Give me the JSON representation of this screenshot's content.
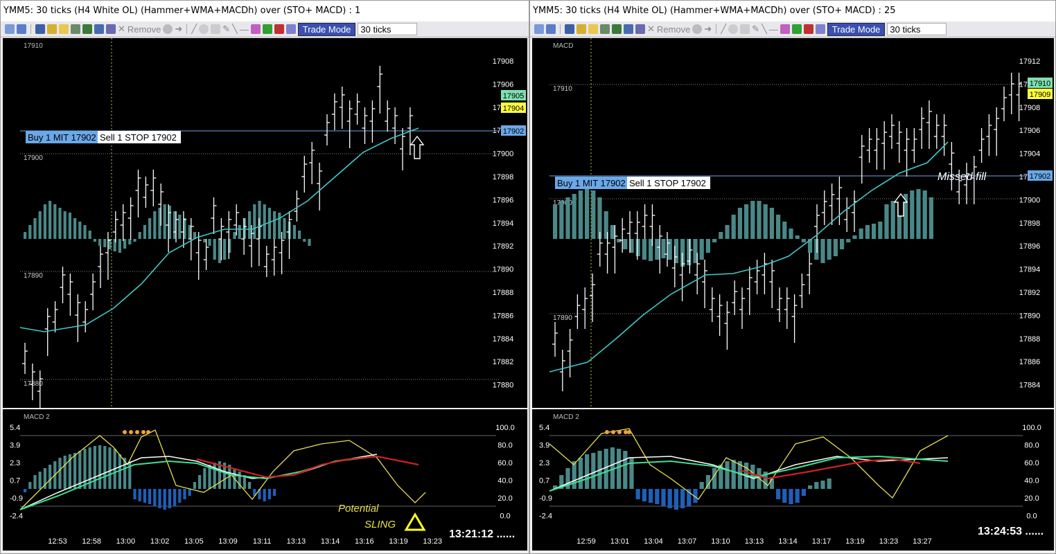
{
  "left": {
    "title": "YMM5: 30 ticks (H4 White OL) (Hammer+WMA+MACDh) over (STO+ MACD) : 1",
    "toolbar": {
      "remove_label": "Remove",
      "trade_mode_label": "Trade Mode",
      "interval_value": "30 ticks"
    },
    "price_panel": {
      "label": "17910",
      "price_ticks": [
        "17908",
        "17906",
        "17904",
        "17902",
        "17900",
        "17898",
        "17896",
        "17894",
        "17892",
        "17890",
        "17888",
        "17886",
        "17884",
        "17882",
        "17880"
      ],
      "level_labels": [
        "17900",
        "17890",
        "17880"
      ],
      "price_flags": [
        {
          "text": "17905",
          "color": "#7ee0b0"
        },
        {
          "text": "17904",
          "color": "#ffff40"
        },
        {
          "text": "17902",
          "color": "#6aa8e8"
        }
      ],
      "order_buy": "Buy 1 MIT 17902",
      "order_sell": "Sell 1 STOP 17902"
    },
    "indicator_panel": {
      "label": "MACD 2",
      "left_ticks": [
        "5.4",
        "3.9",
        "2.3",
        "0.7",
        "-0.9",
        "-2.4"
      ],
      "right_ticks": [
        "100.0",
        "80.0",
        "60.0",
        "40.0",
        "20.0",
        "0.0"
      ],
      "annotation_line1": "Potential",
      "annotation_line2": "SLING"
    },
    "time_axis": [
      "12:53",
      "12:58",
      "13:00",
      "13:02",
      "13:05",
      "13:09",
      "13:11",
      "13:13",
      "13:14",
      "13:16",
      "13:19",
      "13:23"
    ],
    "clock": "13:21:12 ......"
  },
  "right": {
    "title": "YMM5: 30 ticks (H4 White OL) (Hammer+WMA+MACDh) over (STO+ MACD) : 25",
    "toolbar": {
      "remove_label": "Remove",
      "trade_mode_label": "Trade Mode",
      "interval_value": "30 ticks"
    },
    "price_panel": {
      "label": "MACD",
      "price_ticks": [
        "17912",
        "17910",
        "17908",
        "17906",
        "17904",
        "17902",
        "17900",
        "17898",
        "17896",
        "17894",
        "17892",
        "17890",
        "17888",
        "17886",
        "17884"
      ],
      "level_labels": [
        "17910",
        "17900",
        "17890"
      ],
      "price_flags": [
        {
          "text": "17910",
          "color": "#7ee0b0"
        },
        {
          "text": "17909",
          "color": "#ffff40"
        },
        {
          "text": "17902",
          "color": "#6aa8e8"
        }
      ],
      "order_buy": "Buy 1 MIT 17902",
      "order_sell": "Sell 1 STOP 17902",
      "annotation": "Missed fill"
    },
    "indicator_panel": {
      "label": "MACD 2",
      "left_ticks": [
        "5.4",
        "3.9",
        "2.3",
        "0.7",
        "-0.9",
        "-2.4"
      ],
      "right_ticks": [
        "100.0",
        "80.0",
        "60.0",
        "40.0",
        "20.0",
        "0.0"
      ]
    },
    "time_axis": [
      "12:59",
      "13:01",
      "13:04",
      "13:07",
      "13:10",
      "13:13",
      "13:14",
      "13:17",
      "13:19",
      "13:23",
      "13:27"
    ],
    "clock": "13:24:53 ......"
  },
  "colors": {
    "wma": "#40c8c8",
    "macd_hist": "#4a8888",
    "macd_neg": "#1e5fb8",
    "stoch": "#e8e050",
    "signal": "#ffffff",
    "flag_yellow": "#ffff40"
  }
}
